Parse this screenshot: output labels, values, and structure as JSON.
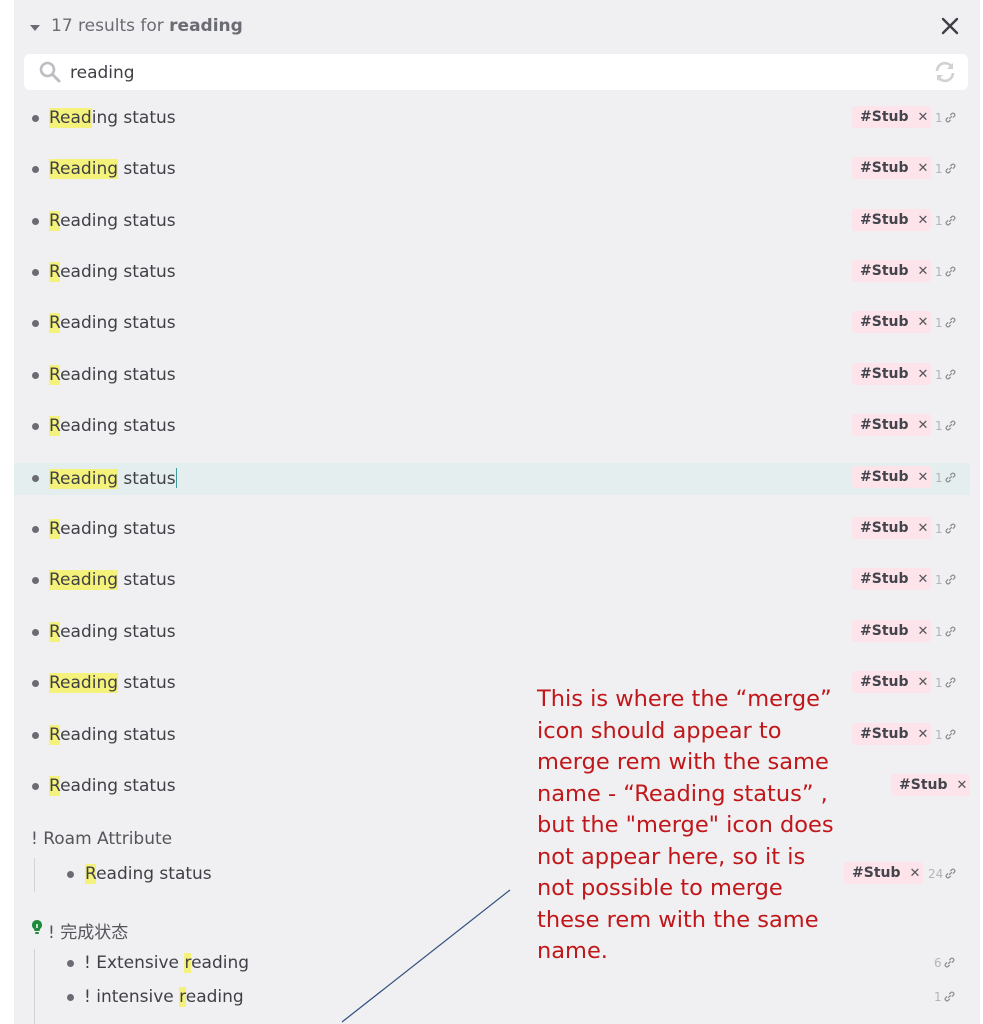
{
  "header": {
    "results_prefix": "17 results for ",
    "query_bold": "reading"
  },
  "search": {
    "value": "reading"
  },
  "rows": [
    {
      "hl": "Read",
      "rest": "ing status",
      "tag": "#Stub",
      "count": "1"
    },
    {
      "hl": "Reading",
      "rest": " status",
      "tag": "#Stub",
      "count": "1"
    },
    {
      "hl": "R",
      "rest": "eading status",
      "tag": "#Stub",
      "count": "1"
    },
    {
      "hl": "R",
      "rest": "eading status",
      "tag": "#Stub",
      "count": "1"
    },
    {
      "hl": "R",
      "rest": "eading status",
      "tag": "#Stub",
      "count": "1"
    },
    {
      "hl": "R",
      "rest": "eading status",
      "tag": "#Stub",
      "count": "1"
    },
    {
      "hl": "R",
      "rest": "eading status",
      "tag": "#Stub",
      "count": "1"
    },
    {
      "hl": "Reading",
      "rest": " status",
      "tag": "#Stub",
      "count": "1"
    },
    {
      "hl": "R",
      "rest": "eading status",
      "tag": "#Stub",
      "count": "1"
    },
    {
      "hl": "Reading",
      "rest": " status",
      "tag": "#Stub",
      "count": "1"
    },
    {
      "hl": "R",
      "rest": "eading status",
      "tag": "#Stub",
      "count": "1"
    },
    {
      "hl": "Reading",
      "rest": " status",
      "tag": "#Stub",
      "count": "1"
    },
    {
      "hl": "R",
      "rest": "eading status",
      "tag": "#Stub",
      "count": "1"
    },
    {
      "hl": "R",
      "rest": "eading status",
      "tag": "#Stub",
      "count": ""
    }
  ],
  "roam_section": {
    "title": "! Roam Attribute",
    "child": {
      "hl": "R",
      "rest": "eading status",
      "tag": "#Stub",
      "count": "24"
    }
  },
  "chinese_section": {
    "title": "! 完成状态",
    "children": [
      {
        "pre": "! Extensive ",
        "hl": "r",
        "rest": "eading",
        "count": "6"
      },
      {
        "pre": "! intensive ",
        "hl": "r",
        "rest": "eading",
        "count": "1"
      }
    ]
  },
  "annotation": {
    "lines": [
      "This is where the “merge”",
      "icon should appear to",
      "merge rem with the same",
      "name - “Reading status” ,",
      "but the \"merge\" icon does",
      "not appear here, so it is",
      "not possible to merge",
      "these rem with the same",
      "name."
    ]
  },
  "colors": {
    "panel_bg": "#f0eff1",
    "highlight": "#f4f27a",
    "tag_bg": "#fce4ea",
    "annotation_text": "#c0171a",
    "selected_row": "#e5eeee"
  },
  "icons": [
    "caret-down-icon",
    "close-icon",
    "search-icon",
    "refresh-icon",
    "link-icon",
    "lightbulb-icon"
  ]
}
